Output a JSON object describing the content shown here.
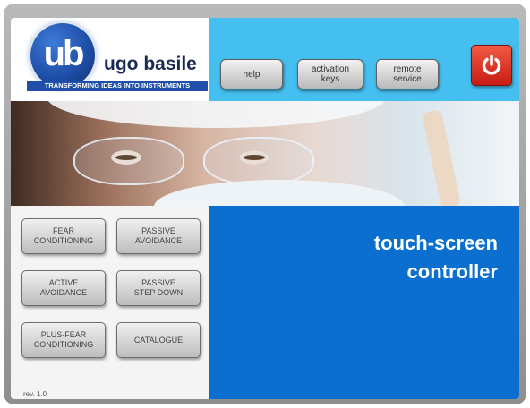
{
  "brand": {
    "logo_letters": "ub",
    "name": "ugo basile",
    "tagline": "TRANSFORMING IDEAS INTO INSTRUMENTS"
  },
  "toolbar": {
    "help_label": "help",
    "activation_keys_label": "activation\nkeys",
    "remote_service_label": "remote\nservice",
    "power_icon": "power-icon"
  },
  "tests": [
    {
      "label": "FEAR\nCONDITIONING"
    },
    {
      "label": "PASSIVE\nAVOIDANCE"
    },
    {
      "label": "ACTIVE\nAVOIDANCE"
    },
    {
      "label": "PASSIVE\nSTEP DOWN"
    },
    {
      "label": "PLUS-FEAR\nCONDITIONING"
    },
    {
      "label": "CATALOGUE"
    }
  ],
  "main": {
    "title": "touch-screen\ncontroller"
  },
  "footer": {
    "revision": "rev. 1.0"
  },
  "colors": {
    "header_blue": "#45bff0",
    "panel_blue": "#0a6fcf",
    "power_red": "#d82a1c"
  }
}
